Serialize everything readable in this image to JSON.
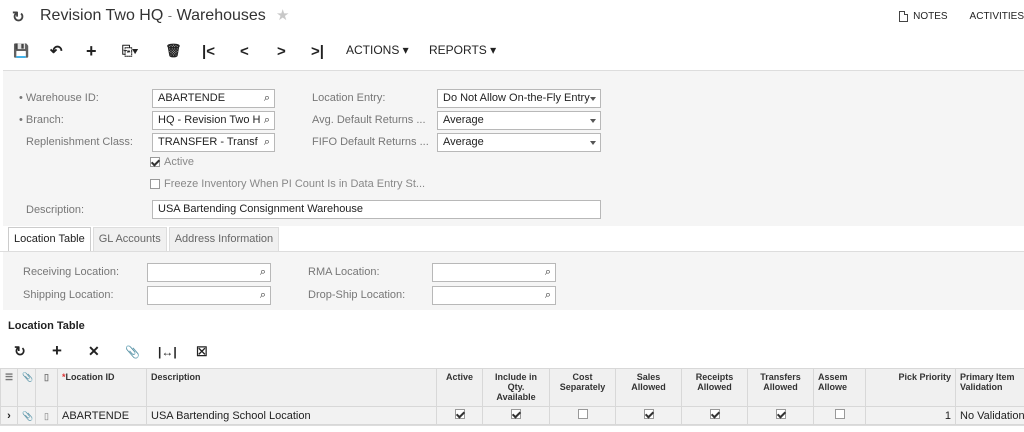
{
  "title": {
    "company": "Revision Two HQ",
    "separator": "-",
    "screen": "Warehouses"
  },
  "top_right": {
    "notes": "NOTES",
    "activities": "ACTIVITIES"
  },
  "toolbar": {
    "actions": "ACTIONS",
    "reports": "REPORTS"
  },
  "form": {
    "warehouse_id": {
      "label": "Warehouse ID:",
      "value": "ABARTENDE"
    },
    "branch": {
      "label": "Branch:",
      "value": "HQ - Revision Two H"
    },
    "replenishment_class": {
      "label": "Replenishment Class:",
      "value": "TRANSFER - Transf"
    },
    "active_label": "Active",
    "freeze_label": "Freeze Inventory When PI Count Is in Data Entry St...",
    "description": {
      "label": "Description:",
      "value": "USA Bartending Consignment Warehouse"
    },
    "location_entry": {
      "label": "Location Entry:",
      "value": "Do Not Allow On-the-Fly Entry"
    },
    "avg_default_returns": {
      "label": "Avg. Default Returns ...",
      "value": "Average"
    },
    "fifo_default_returns": {
      "label": "FIFO Default Returns ...",
      "value": "Average"
    }
  },
  "tabs": [
    "Location Table",
    "GL Accounts",
    "Address Information"
  ],
  "locations": {
    "receiving_label": "Receiving Location:",
    "shipping_label": "Shipping Location:",
    "rma_label": "RMA Location:",
    "dropship_label": "Drop-Ship Location:"
  },
  "section_title": "Location Table",
  "grid": {
    "headers": {
      "location_id": "Location ID",
      "description": "Description",
      "active": "Active",
      "include_qty": "Include in Qty. Available",
      "cost_sep": "Cost Separately",
      "sales": "Sales Allowed",
      "receipts": "Receipts Allowed",
      "transfers": "Transfers Allowed",
      "assem": "Assem Allowe",
      "pick": "Pick Priority",
      "primary": "Primary Item Validation"
    },
    "row": {
      "location_id": "ABARTENDE",
      "description": "USA Bartending School Location",
      "pick_priority": "1",
      "primary_validation": "No Validation"
    }
  }
}
